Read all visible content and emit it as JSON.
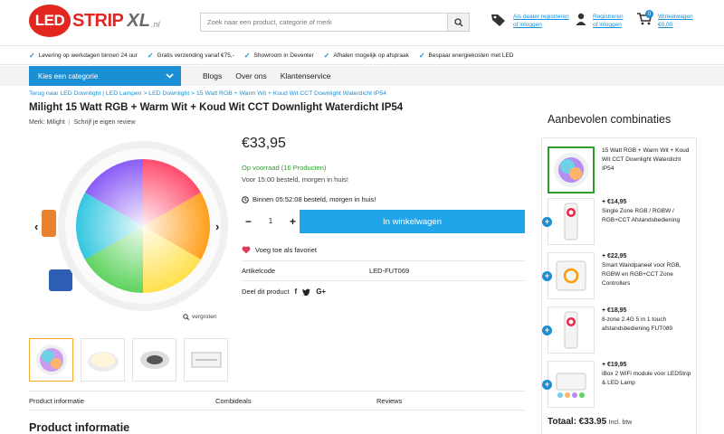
{
  "brand": {
    "led": "LED",
    "strip": "STRIP",
    "xl": "XL",
    "tld": ".nl"
  },
  "search": {
    "placeholder": "Zoek naar een product, categorie of merk"
  },
  "header_links": {
    "dealer": [
      "Als dealer registreren",
      "of inloggen"
    ],
    "account": [
      "Registreren",
      "of inloggen"
    ],
    "cart": [
      "Winkelwagen",
      "€0,00"
    ],
    "cart_count": "0"
  },
  "usps": [
    "Levering op werkdagen binnen 24 uur",
    "Gratis verzending vanaf €75,-",
    "Showroom in Deventer",
    "Afhalen mogelijk op afspraak",
    "Bespaar energiekosten met LED"
  ],
  "nav": {
    "category_label": "Kies een categorie",
    "items": [
      "Blogs",
      "Over ons",
      "Klantenservice"
    ]
  },
  "breadcrumb": "Terug naar LED Downlight | LED Lampen > LED Downlight > 15 Watt RGB + Warm Wit + Koud Wit CCT Downlight Waterdicht IP54",
  "product": {
    "title": "Milight 15 Watt RGB + Warm Wit + Koud Wit CCT Downlight Waterdicht IP54",
    "brand_label": "Merk: Milight",
    "review_link": "Schrijf je eigen review",
    "price": "€33,95",
    "stock": "Op voorraad (16 Producten)",
    "delivery": "Voor 15:00 besteld, morgen in huis!",
    "timer": "Binnen 05:52:08 besteld, morgen in huis!",
    "quantity": "1",
    "add_to_cart": "In winkelwagen",
    "favorite": "Voeg toe als favoriet",
    "article_label": "Artikelcode",
    "article_code": "LED-FUT069",
    "share_label": "Deel dit product",
    "zoom_label": "vergroten"
  },
  "tabs": [
    "Product informatie",
    "Combideals",
    "Reviews"
  ],
  "section_heading": "Product informatie",
  "sidebar": {
    "heading": "Aanbevolen combinaties",
    "items": [
      {
        "price": "",
        "name": "15 Watt RGB + Warm Wit + Koud Wit CCT Downlight Waterdicht IP54"
      },
      {
        "price": "+ €14,95",
        "name": "Single Zone RGB / RGBW / RGB+CCT Afstandsbediening"
      },
      {
        "price": "+ €22,95",
        "name": "Smart Wandpaneel voor RGB, RGBW en RGB+CCT Zone Controllers"
      },
      {
        "price": "+ €18,95",
        "name": "8-zone 2.4G 5 in 1 touch afstandsbediening FUT089"
      },
      {
        "price": "+ €19,95",
        "name": "iBox 2 WiFi module voor LEDStrip & LED Lamp"
      }
    ],
    "total_label": "Totaal:",
    "total_value": "€33.95",
    "total_suffix": "Incl. btw"
  },
  "colors": {
    "brand_red": "#e3261f",
    "accent_blue": "#1a8fd6",
    "cart_button": "#21a5ea",
    "stock_green": "#2e9e2e"
  }
}
